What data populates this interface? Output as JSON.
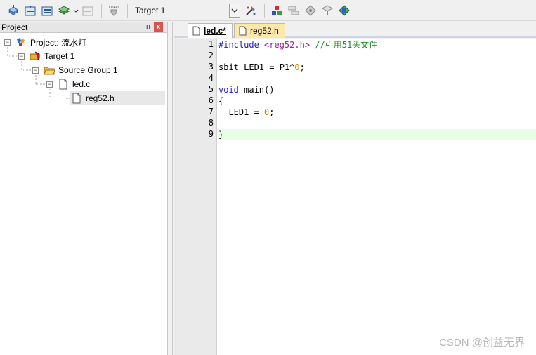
{
  "toolbar": {
    "target_select": "Target 1",
    "icons": [
      "translate-icon",
      "build-icon",
      "rebuild-icon",
      "batch-build-icon",
      "stop-build-icon",
      "download-icon",
      "target-options-icon",
      "manage-components-icon",
      "file-extensions-icon",
      "select-packs-icon",
      "pack-installer-icon",
      "rte-icon"
    ]
  },
  "project_panel": {
    "title": "Project",
    "pin": "ᴨ",
    "close": "x",
    "tree": {
      "project": "Project: 流水灯",
      "target": "Target 1",
      "group": "Source Group 1",
      "file1": "led.c",
      "file2": "reg52.h"
    }
  },
  "tabs": [
    {
      "label": "led.c*",
      "active": true
    },
    {
      "label": "reg52.h",
      "active": false
    }
  ],
  "editor": {
    "line_numbers": [
      "1",
      "2",
      "3",
      "4",
      "5",
      "6",
      "7",
      "8",
      "9"
    ],
    "lines": {
      "l1_a": "#include ",
      "l1_b": "<reg52.h>",
      "l1_c": " //引用51头文件",
      "l3_a": "sbit LED1 = P1^",
      "l3_b": "0",
      "l3_c": ";",
      "l5_a": "void",
      "l5_b": " main()",
      "l6": "{",
      "l7_a": "  LED1 = ",
      "l7_b": "0",
      "l7_c": ";",
      "l9": "}"
    },
    "current_line": 9
  },
  "watermark": "CSDN @创益无界"
}
